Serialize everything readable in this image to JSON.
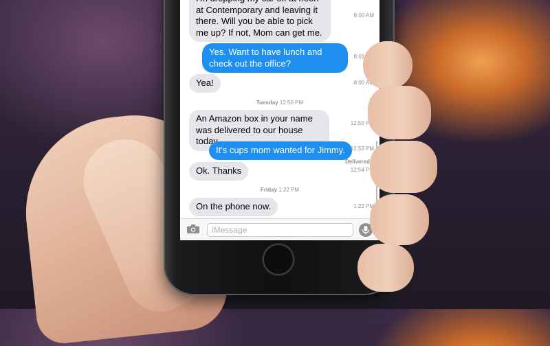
{
  "messages": [
    {
      "type": "in",
      "text": "I'm dropping my car off at noon at Contemporary and leaving it there. Will you be able to pick me up? If not, Mom can get me.",
      "time": "8:00 AM"
    },
    {
      "type": "out",
      "text": "Yes. Want to have lunch and check out the office?",
      "time": "8:01 AM"
    },
    {
      "type": "in",
      "text": "Yea!",
      "time": "8:00 AM"
    },
    {
      "type": "day",
      "day": "Tuesday",
      "time": "12:50 PM"
    },
    {
      "type": "in",
      "text": "An Amazon box in your name was delivered to our house today.",
      "time": "12:50 PM"
    },
    {
      "type": "out",
      "text": "It's cups mom wanted for Jimmy.",
      "time": "12:53 PM",
      "status": "Delivered"
    },
    {
      "type": "in",
      "text": "Ok. Thanks",
      "time": "12:54 PM"
    },
    {
      "type": "day",
      "day": "Friday",
      "time": "1:22 PM"
    },
    {
      "type": "in",
      "text": "On the phone now.",
      "time": "1:22 PM"
    }
  ],
  "composer": {
    "placeholder": "iMessage",
    "camera_icon": "camera-icon",
    "mic_icon": "microphone-icon"
  },
  "colors": {
    "incoming_bubble": "#e5e5ea",
    "outgoing_bubble": "#1f8ef1",
    "timestamp": "#8e8e93"
  }
}
